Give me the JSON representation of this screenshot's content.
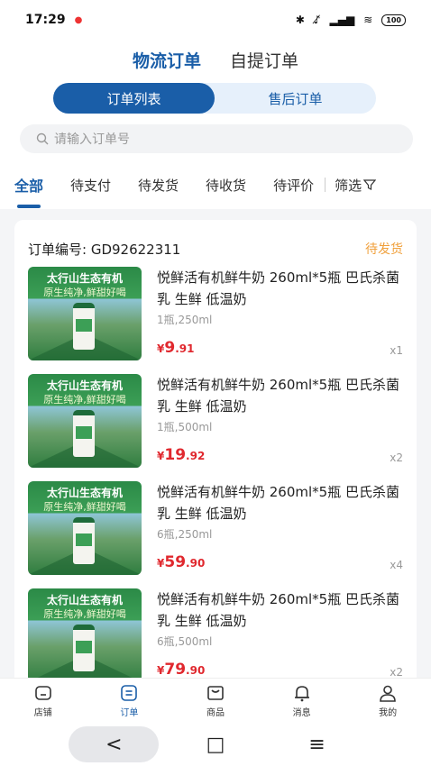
{
  "status_bar": {
    "time": "17:29",
    "battery": "100"
  },
  "header": {
    "tabs": [
      {
        "label": "物流订单",
        "active": true
      },
      {
        "label": "自提订单",
        "active": false
      }
    ]
  },
  "segment": {
    "options": [
      {
        "label": "订单列表",
        "active": true
      },
      {
        "label": "售后订单",
        "active": false
      }
    ]
  },
  "search": {
    "placeholder": "请输入订单号"
  },
  "filter_tabs": {
    "items": [
      "全部",
      "待支付",
      "待发货",
      "待收货",
      "待评价"
    ],
    "screen_label": "筛选"
  },
  "order": {
    "number_label": "订单编号: GD92622311",
    "status": "待发货",
    "items": [
      {
        "image_text_1": "太行山生态有机",
        "image_text_2": "原生纯净,鲜甜好喝",
        "title": "悦鲜活有机鲜牛奶 260ml*5瓶 巴氏杀菌乳 生鲜 低温奶",
        "spec": "1瓶,250ml",
        "currency": "¥",
        "price_int": "9",
        "price_dec": ".91",
        "qty": "x1"
      },
      {
        "image_text_1": "太行山生态有机",
        "image_text_2": "原生纯净,鲜甜好喝",
        "title": "悦鲜活有机鲜牛奶 260ml*5瓶 巴氏杀菌乳 生鲜 低温奶",
        "spec": "1瓶,500ml",
        "currency": "¥",
        "price_int": "19",
        "price_dec": ".92",
        "qty": "x2"
      },
      {
        "image_text_1": "太行山生态有机",
        "image_text_2": "原生纯净,鲜甜好喝",
        "title": "悦鲜活有机鲜牛奶 260ml*5瓶 巴氏杀菌乳 生鲜 低温奶",
        "spec": "6瓶,250ml",
        "currency": "¥",
        "price_int": "59",
        "price_dec": ".90",
        "qty": "x4"
      },
      {
        "image_text_1": "太行山生态有机",
        "image_text_2": "原生纯净,鲜甜好喝",
        "title": "悦鲜活有机鲜牛奶 260ml*5瓶 巴氏杀菌乳 生鲜 低温奶",
        "spec": "6瓶,500ml",
        "currency": "¥",
        "price_int": "79",
        "price_dec": ".90",
        "qty": "x2"
      }
    ]
  },
  "bottom_nav": {
    "items": [
      {
        "label": "店铺",
        "icon": "store-icon"
      },
      {
        "label": "订单",
        "icon": "order-icon",
        "active": true
      },
      {
        "label": "商品",
        "icon": "product-icon"
      },
      {
        "label": "消息",
        "icon": "bell-icon"
      },
      {
        "label": "我的",
        "icon": "user-icon"
      }
    ]
  },
  "sys_nav": {
    "back": "<",
    "home": "□",
    "menu": "≡"
  },
  "colors": {
    "accent": "#1a5ea8",
    "price": "#e0282e",
    "status": "#f0a03c"
  }
}
